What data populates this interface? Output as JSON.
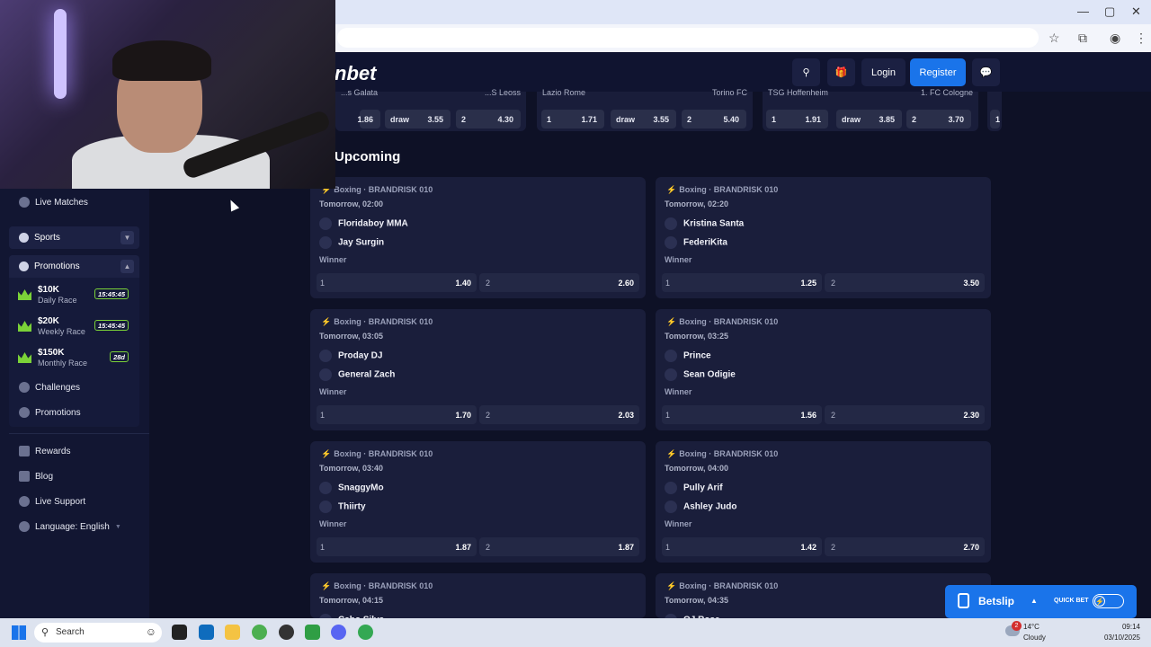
{
  "browser": {
    "minimize_glyph": "—",
    "maximize_glyph": "▢",
    "close_glyph": "✕",
    "star_icon": "star-icon",
    "extension_icon": "puzzle-icon",
    "profile_icon": "profile-icon",
    "menu_glyph": "⋮"
  },
  "header": {
    "brand": "nbet",
    "login_label": "Login",
    "register_label": "Register",
    "search_glyph": "⚲",
    "gift_glyph": "🎁",
    "chat_glyph": "💬",
    "accent": "#1a74ea"
  },
  "sidebar": {
    "live_matches": "Live Matches",
    "sports": "Sports",
    "promotions_header": "Promotions",
    "races": [
      {
        "amount": "$10K",
        "name": "Daily Race",
        "timer": "15:45:45"
      },
      {
        "amount": "$20K",
        "name": "Weekly Race",
        "timer": "15:45:45"
      },
      {
        "amount": "$150K",
        "name": "Monthly Race",
        "timer": "28d"
      }
    ],
    "challenges": "Challenges",
    "promotions": "Promotions",
    "rewards": "Rewards",
    "blog": "Blog",
    "live_support": "Live Support",
    "language": "Language: English"
  },
  "teasers": [
    {
      "team_left": "...s Galata",
      "team_right": "...S Leoss",
      "odds": [
        {
          "label": "",
          "value": "1.86"
        },
        {
          "label": "draw",
          "value": "3.55"
        },
        {
          "label": "2",
          "value": "4.30"
        }
      ]
    },
    {
      "team_left": "Lazio Rome",
      "team_right": "Torino FC",
      "odds": [
        {
          "label": "1",
          "value": "1.71"
        },
        {
          "label": "draw",
          "value": "3.55"
        },
        {
          "label": "2",
          "value": "5.40"
        }
      ]
    },
    {
      "team_left": "TSG Hoffenheim",
      "team_right": "1. FC Cologne",
      "odds": [
        {
          "label": "1",
          "value": "1.91"
        },
        {
          "label": "draw",
          "value": "3.85"
        },
        {
          "label": "2",
          "value": "3.70"
        }
      ]
    },
    {
      "team_left": "",
      "team_right": "",
      "odds": [
        {
          "label": "1",
          "value": ""
        }
      ]
    }
  ],
  "upcoming": {
    "title": "Upcoming",
    "matches": [
      {
        "league": "Boxing · BRANDRISK 010",
        "time": "Tomorrow, 02:00",
        "team1": "Floridaboy MMA",
        "team2": "Jay Surgin",
        "market": "Winner",
        "odd1_label": "1",
        "odd1": "1.40",
        "odd2_label": "2",
        "odd2": "2.60"
      },
      {
        "league": "Boxing · BRANDRISK 010",
        "time": "Tomorrow, 02:20",
        "team1": "Kristina Santa",
        "team2": "FederiKita",
        "market": "Winner",
        "odd1_label": "1",
        "odd1": "1.25",
        "odd2_label": "2",
        "odd2": "3.50"
      },
      {
        "league": "Boxing · BRANDRISK 010",
        "time": "Tomorrow, 03:05",
        "team1": "Proday DJ",
        "team2": "General Zach",
        "market": "Winner",
        "odd1_label": "1",
        "odd1": "1.70",
        "odd2_label": "2",
        "odd2": "2.03"
      },
      {
        "league": "Boxing · BRANDRISK 010",
        "time": "Tomorrow, 03:25",
        "team1": "Prince",
        "team2": "Sean Odigie",
        "market": "Winner",
        "odd1_label": "1",
        "odd1": "1.56",
        "odd2_label": "2",
        "odd2": "2.30"
      },
      {
        "league": "Boxing · BRANDRISK 010",
        "time": "Tomorrow, 03:40",
        "team1": "SnaggyMo",
        "team2": "Thiirty",
        "market": "Winner",
        "odd1_label": "1",
        "odd1": "1.87",
        "odd2_label": "2",
        "odd2": "1.87"
      },
      {
        "league": "Boxing · BRANDRISK 010",
        "time": "Tomorrow, 04:00",
        "team1": "Pully Arif",
        "team2": "Ashley Judo",
        "market": "Winner",
        "odd1_label": "1",
        "odd1": "1.42",
        "odd2_label": "2",
        "odd2": "2.70"
      },
      {
        "league": "Boxing · BRANDRISK 010",
        "time": "Tomorrow, 04:15",
        "team1": "Cabo Silva",
        "team2": "",
        "market": "",
        "odd1_label": "",
        "odd1": "",
        "odd2_label": "",
        "odd2": ""
      },
      {
        "league": "Boxing · BRANDRISK 010",
        "time": "Tomorrow, 04:35",
        "team1": "OJ Rose",
        "team2": "",
        "market": "",
        "odd1_label": "",
        "odd1": "",
        "odd2_label": "",
        "odd2": ""
      }
    ]
  },
  "betslip": {
    "label": "Betslip",
    "quick_bet": "QUICK BET",
    "caret": "▲",
    "bolt": "⚡"
  },
  "taskbar": {
    "search_placeholder": "Search",
    "weather_temp": "14°C",
    "weather_desc": "Cloudy",
    "notif_count": "2",
    "time": "09:14",
    "date": "03/10/2025"
  }
}
